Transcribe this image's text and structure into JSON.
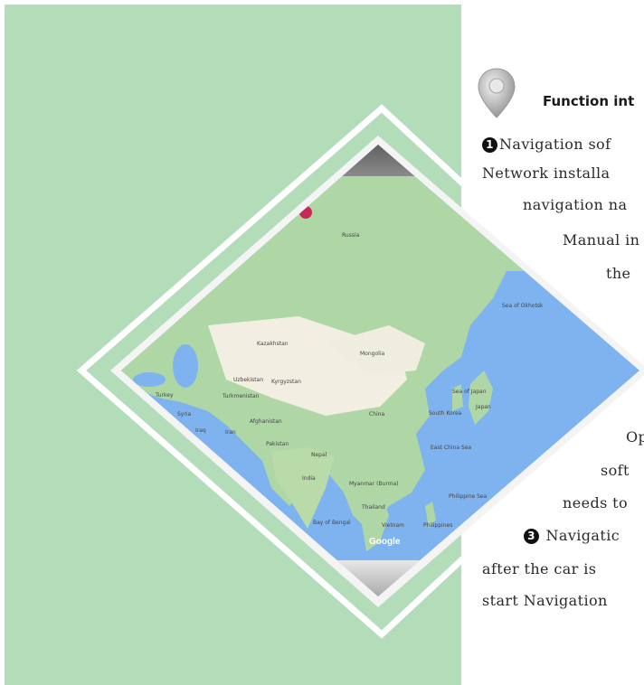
{
  "heading": "Function int",
  "lines": [
    {
      "num": "1",
      "text": "Navigation sof"
    },
    {
      "text": "Network installa"
    },
    {
      "text": "navigation na"
    },
    {
      "text": "Manual in"
    },
    {
      "text": "the"
    },
    {
      "text": "Op"
    },
    {
      "text": "soft"
    },
    {
      "text": "needs to"
    },
    {
      "num": "3",
      "text": "Navigatic"
    },
    {
      "text": "after the car is"
    },
    {
      "text": "start Navigation"
    }
  ],
  "map": {
    "labels": [
      "Russia",
      "Kazakhstan",
      "Mongolia",
      "Uzbekistan",
      "Kyrgyzstan",
      "Turkmenistan",
      "Turkey",
      "Syria",
      "Iraq",
      "Iran",
      "Afghanistan",
      "Pakistan",
      "China",
      "South Korea",
      "Japan",
      "Sea of Japan",
      "Sea of Okhotsk",
      "East China Sea",
      "Nepal",
      "India",
      "Myanmar (Burma)",
      "Thailand",
      "Bay of Bengal",
      "Vietnam",
      "Philippines",
      "Philippine Sea"
    ],
    "logo": "Google"
  },
  "colors": {
    "panel": "#b3dcb8",
    "frame": "#ffffff",
    "water": "#7eb3f0",
    "land": "#aed7a5",
    "desert": "#f2efe2"
  },
  "icons": [
    "map-pin-icon",
    "number-one-icon",
    "number-three-icon"
  ]
}
